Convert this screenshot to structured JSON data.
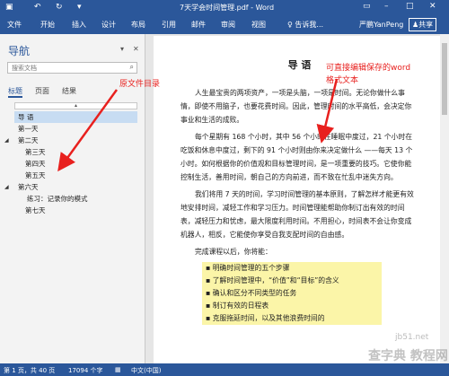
{
  "titlebar": {
    "title": "7天学会时间管理.pdf - Word",
    "save_icon": "save-icon",
    "undo_icon": "undo-icon",
    "redo_icon": "redo-icon"
  },
  "ribbon": {
    "tabs": [
      "文件",
      "开始",
      "插入",
      "设计",
      "布局",
      "引用",
      "邮件",
      "审阅",
      "视图"
    ],
    "tell_me": "告诉我...",
    "user": "严鹏YanPeng",
    "share": "共享"
  },
  "nav": {
    "title": "导航",
    "search_placeholder": "搜索文档",
    "tabs": [
      "标题",
      "页面",
      "结果"
    ],
    "outline": [
      {
        "label": "导 语",
        "level": 1,
        "selected": true
      },
      {
        "label": "第一天",
        "level": 1
      },
      {
        "label": "第二天",
        "level": 1
      },
      {
        "label": "第三天",
        "level": 2
      },
      {
        "label": "第四天",
        "level": 2
      },
      {
        "label": "第五天",
        "level": 2
      },
      {
        "label": "第六天",
        "level": 1
      },
      {
        "label": "练习：记录你的模式",
        "level": 3
      },
      {
        "label": "第七天",
        "level": 2
      }
    ]
  },
  "annotations": {
    "left": "原文件目录",
    "right_line1": "可直接编辑保存的word",
    "right_line2": "格式文本"
  },
  "document": {
    "heading": "导 语",
    "p1": "人生最宝贵的两项资产，一项是头脑，一项是时间。无论你做什么事情，即使不用脑子，也要花费时间。因此，管理时间的水平高低，会决定你事业和生活的成败。",
    "p2": "每个星期有 168 个小时，其中 56 个小时在睡眠中度过，21 个小时在吃饭和休息中度过，剩下的 91 个小时则由你来决定做什么 ——每天 13 个小时。如何根据你的价值观和目标管理时间，是一项重要的技巧。它使你能控制生活，善用时间，朝自己的方向前进，而不致在忙乱中迷失方向。",
    "p3": "我们将用 7 天的时间，学习时间管理的基本原则，了解怎样才能更有效地安排时间，减轻工作和学习压力。时间管理能帮助你制订出有效的时间表，减轻压力和忧虑，最大限度利用时间。不用担心，时间表不会让你变成机器人，相反，它能使你享受自我支配时间的自由感。",
    "p4": "完成课程以后，你将能：",
    "list": [
      "明确时间管理的五个步骤",
      "了解时间管理中，“价值”和“目标”的含义",
      "确认和区分不同类型的任务",
      "制订有效的日程表",
      "克服拖延时间，以及其他浪费时间的"
    ]
  },
  "status": {
    "page": "第 1 页，共 40 页",
    "words": "17094 个字",
    "lang": "中文(中国)"
  },
  "watermark": {
    "site": "jb51.net",
    "brand": "查字典 教程网"
  }
}
